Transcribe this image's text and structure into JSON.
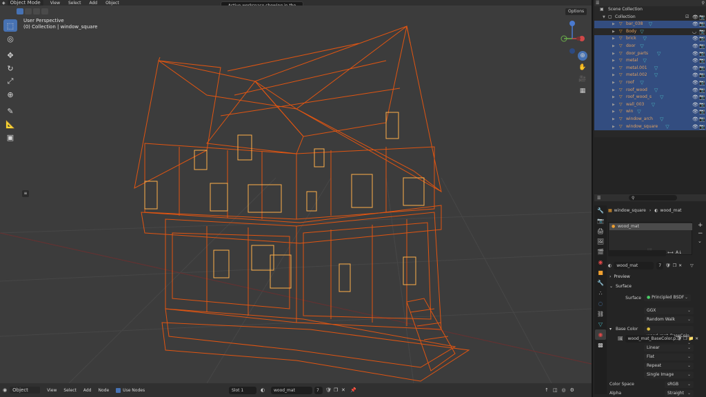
{
  "topbar": {
    "mode": "Object Mode",
    "menus": [
      "View",
      "Select",
      "Add",
      "Object"
    ]
  },
  "tooltip": "Active workspace showing in the window.",
  "viewport": {
    "perspective": "User Perspective",
    "collection": "(0) Collection | window_square",
    "options": "Options",
    "background_color": "#3c3c3c",
    "wire_color": "#ff5a0a"
  },
  "toolbar": {
    "tools": [
      "select-box-icon",
      "cursor-icon",
      "move-icon",
      "rotate-icon",
      "scale-icon",
      "transform-icon",
      "annotate-icon",
      "measure-icon",
      "add-cube-icon"
    ]
  },
  "gizmo": {
    "x": "X",
    "y": "Y",
    "z": "Z"
  },
  "outliner": {
    "scene_collection": "Scene Collection",
    "collection": "Collection",
    "items": [
      {
        "name": "bar_038",
        "selected": true
      },
      {
        "name": "Body",
        "selected": false
      },
      {
        "name": "brick",
        "selected": true
      },
      {
        "name": "door",
        "selected": true
      },
      {
        "name": "door_parts",
        "selected": true
      },
      {
        "name": "metal",
        "selected": true
      },
      {
        "name": "metal.001",
        "selected": true
      },
      {
        "name": "metal.002",
        "selected": true
      },
      {
        "name": "roof",
        "selected": true
      },
      {
        "name": "roof_wood",
        "selected": true
      },
      {
        "name": "roof_wood_s",
        "selected": true
      },
      {
        "name": "wall_003",
        "selected": true
      },
      {
        "name": "win",
        "selected": true
      },
      {
        "name": "window_arch",
        "selected": true
      },
      {
        "name": "window_square",
        "selected": true
      }
    ]
  },
  "properties": {
    "breadcrumb_object": "window_square",
    "breadcrumb_material": "wood_mat",
    "slot_material": "wood_mat",
    "material_name": "wood_mat",
    "users": "7",
    "preview_label": "Preview",
    "surface_label": "Surface",
    "surface_field_label": "Surface",
    "surface_value": "Principled BSDF",
    "distribution": "GGX",
    "subsurface": "Random Walk",
    "base_color_label": "Base Color",
    "base_color_value": "wood_mat_BaseColo...",
    "image_name": "wood_mat_BaseColor.p...",
    "interpolation": "Linear",
    "projection": "Flat",
    "extension": "Repeat",
    "source": "Single Image",
    "color_space_label": "Color Space",
    "color_space_value": "sRGB",
    "alpha_label": "Alpha",
    "alpha_value": "Straight"
  },
  "bottombar": {
    "mode": "Object",
    "menus": [
      "View",
      "Select",
      "Add",
      "Node"
    ],
    "use_nodes": "Use Nodes",
    "slot": "Slot 1",
    "material": "wood_mat",
    "users": "7"
  }
}
